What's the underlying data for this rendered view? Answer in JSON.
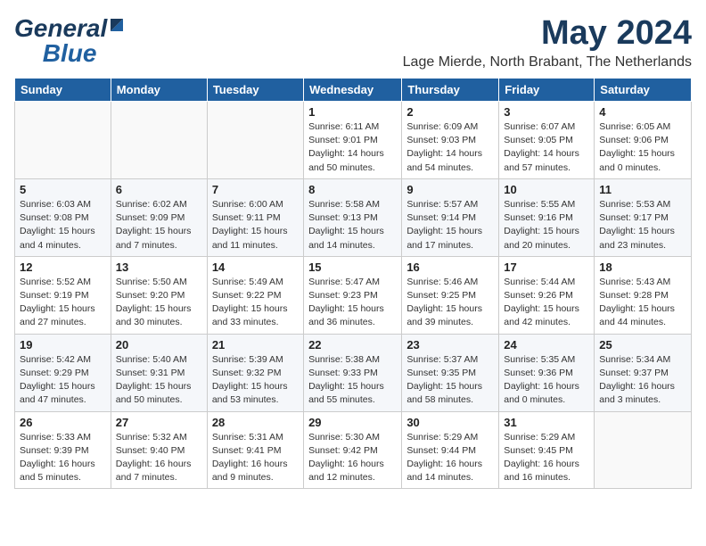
{
  "header": {
    "logo_general": "General",
    "logo_blue": "Blue",
    "month_year": "May 2024",
    "location": "Lage Mierde, North Brabant, The Netherlands"
  },
  "weekdays": [
    "Sunday",
    "Monday",
    "Tuesday",
    "Wednesday",
    "Thursday",
    "Friday",
    "Saturday"
  ],
  "weeks": [
    [
      {
        "day": "",
        "info": ""
      },
      {
        "day": "",
        "info": ""
      },
      {
        "day": "",
        "info": ""
      },
      {
        "day": "1",
        "info": "Sunrise: 6:11 AM\nSunset: 9:01 PM\nDaylight: 14 hours\nand 50 minutes."
      },
      {
        "day": "2",
        "info": "Sunrise: 6:09 AM\nSunset: 9:03 PM\nDaylight: 14 hours\nand 54 minutes."
      },
      {
        "day": "3",
        "info": "Sunrise: 6:07 AM\nSunset: 9:05 PM\nDaylight: 14 hours\nand 57 minutes."
      },
      {
        "day": "4",
        "info": "Sunrise: 6:05 AM\nSunset: 9:06 PM\nDaylight: 15 hours\nand 0 minutes."
      }
    ],
    [
      {
        "day": "5",
        "info": "Sunrise: 6:03 AM\nSunset: 9:08 PM\nDaylight: 15 hours\nand 4 minutes."
      },
      {
        "day": "6",
        "info": "Sunrise: 6:02 AM\nSunset: 9:09 PM\nDaylight: 15 hours\nand 7 minutes."
      },
      {
        "day": "7",
        "info": "Sunrise: 6:00 AM\nSunset: 9:11 PM\nDaylight: 15 hours\nand 11 minutes."
      },
      {
        "day": "8",
        "info": "Sunrise: 5:58 AM\nSunset: 9:13 PM\nDaylight: 15 hours\nand 14 minutes."
      },
      {
        "day": "9",
        "info": "Sunrise: 5:57 AM\nSunset: 9:14 PM\nDaylight: 15 hours\nand 17 minutes."
      },
      {
        "day": "10",
        "info": "Sunrise: 5:55 AM\nSunset: 9:16 PM\nDaylight: 15 hours\nand 20 minutes."
      },
      {
        "day": "11",
        "info": "Sunrise: 5:53 AM\nSunset: 9:17 PM\nDaylight: 15 hours\nand 23 minutes."
      }
    ],
    [
      {
        "day": "12",
        "info": "Sunrise: 5:52 AM\nSunset: 9:19 PM\nDaylight: 15 hours\nand 27 minutes."
      },
      {
        "day": "13",
        "info": "Sunrise: 5:50 AM\nSunset: 9:20 PM\nDaylight: 15 hours\nand 30 minutes."
      },
      {
        "day": "14",
        "info": "Sunrise: 5:49 AM\nSunset: 9:22 PM\nDaylight: 15 hours\nand 33 minutes."
      },
      {
        "day": "15",
        "info": "Sunrise: 5:47 AM\nSunset: 9:23 PM\nDaylight: 15 hours\nand 36 minutes."
      },
      {
        "day": "16",
        "info": "Sunrise: 5:46 AM\nSunset: 9:25 PM\nDaylight: 15 hours\nand 39 minutes."
      },
      {
        "day": "17",
        "info": "Sunrise: 5:44 AM\nSunset: 9:26 PM\nDaylight: 15 hours\nand 42 minutes."
      },
      {
        "day": "18",
        "info": "Sunrise: 5:43 AM\nSunset: 9:28 PM\nDaylight: 15 hours\nand 44 minutes."
      }
    ],
    [
      {
        "day": "19",
        "info": "Sunrise: 5:42 AM\nSunset: 9:29 PM\nDaylight: 15 hours\nand 47 minutes."
      },
      {
        "day": "20",
        "info": "Sunrise: 5:40 AM\nSunset: 9:31 PM\nDaylight: 15 hours\nand 50 minutes."
      },
      {
        "day": "21",
        "info": "Sunrise: 5:39 AM\nSunset: 9:32 PM\nDaylight: 15 hours\nand 53 minutes."
      },
      {
        "day": "22",
        "info": "Sunrise: 5:38 AM\nSunset: 9:33 PM\nDaylight: 15 hours\nand 55 minutes."
      },
      {
        "day": "23",
        "info": "Sunrise: 5:37 AM\nSunset: 9:35 PM\nDaylight: 15 hours\nand 58 minutes."
      },
      {
        "day": "24",
        "info": "Sunrise: 5:35 AM\nSunset: 9:36 PM\nDaylight: 16 hours\nand 0 minutes."
      },
      {
        "day": "25",
        "info": "Sunrise: 5:34 AM\nSunset: 9:37 PM\nDaylight: 16 hours\nand 3 minutes."
      }
    ],
    [
      {
        "day": "26",
        "info": "Sunrise: 5:33 AM\nSunset: 9:39 PM\nDaylight: 16 hours\nand 5 minutes."
      },
      {
        "day": "27",
        "info": "Sunrise: 5:32 AM\nSunset: 9:40 PM\nDaylight: 16 hours\nand 7 minutes."
      },
      {
        "day": "28",
        "info": "Sunrise: 5:31 AM\nSunset: 9:41 PM\nDaylight: 16 hours\nand 9 minutes."
      },
      {
        "day": "29",
        "info": "Sunrise: 5:30 AM\nSunset: 9:42 PM\nDaylight: 16 hours\nand 12 minutes."
      },
      {
        "day": "30",
        "info": "Sunrise: 5:29 AM\nSunset: 9:44 PM\nDaylight: 16 hours\nand 14 minutes."
      },
      {
        "day": "31",
        "info": "Sunrise: 5:29 AM\nSunset: 9:45 PM\nDaylight: 16 hours\nand 16 minutes."
      },
      {
        "day": "",
        "info": ""
      }
    ]
  ]
}
